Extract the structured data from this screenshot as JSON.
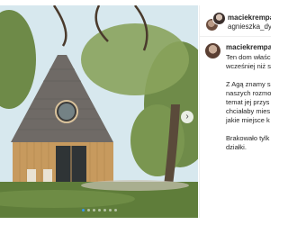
{
  "post": {
    "author_username": "maciekrempala",
    "tagged_username": "agnieszka_dyg",
    "caption_lines": [
      "Ten dom właśc",
      "wcześniej niż s",
      "",
      "Z Agą znamy s",
      "naszych rozmo",
      "temat jej przys",
      "chciałaby mies",
      "jakie miejsce k",
      "",
      "Brakowało tylk",
      "działki."
    ]
  },
  "carousel": {
    "slide_count": 7,
    "active_index": 0,
    "next_glyph": "›"
  },
  "colors": {
    "active_dot": "#3897f0",
    "wood": "#c79a5e",
    "roof": "#6f6a66",
    "sky": "#d6e8ef",
    "grass": "#5f7d3a"
  }
}
